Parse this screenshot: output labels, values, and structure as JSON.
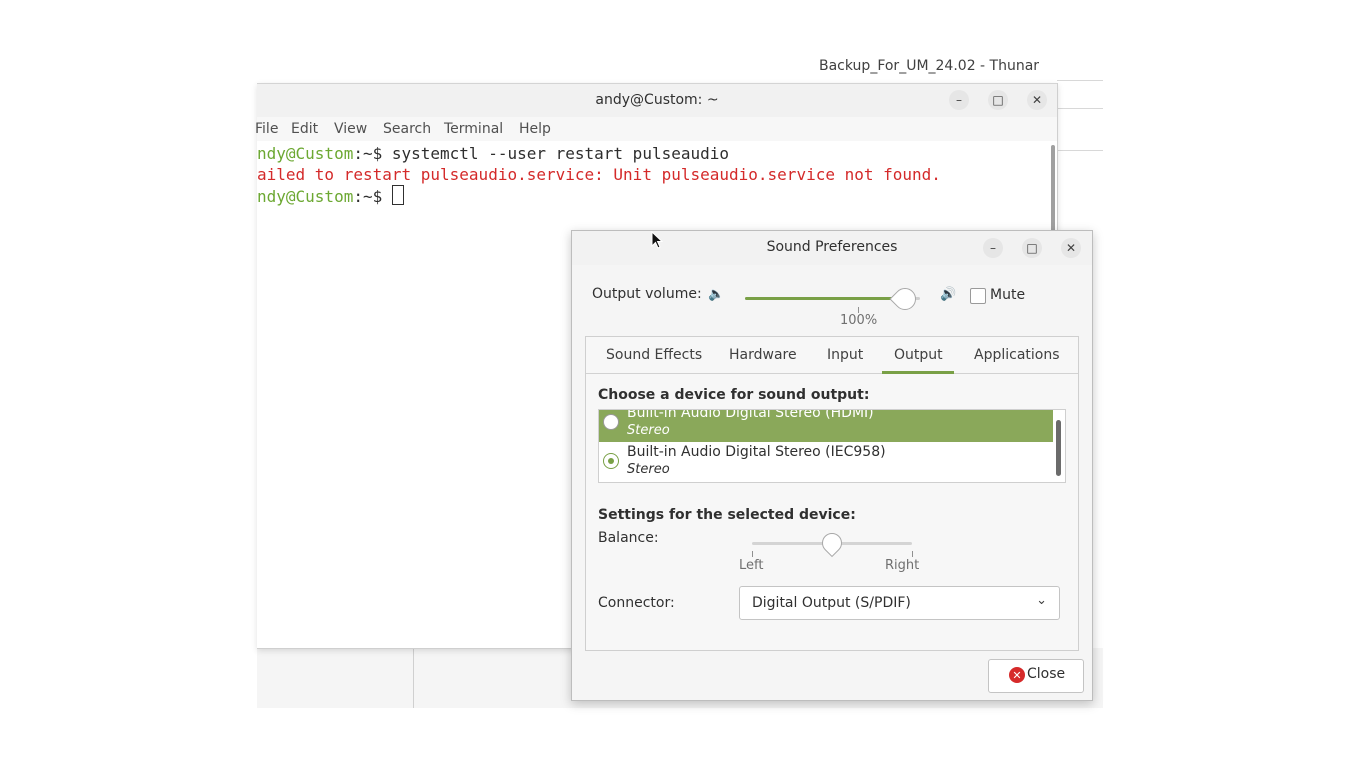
{
  "thunar": {
    "title": "Backup_For_UM_24.02 - Thunar"
  },
  "terminal": {
    "title": "andy@Custom: ~",
    "menu": [
      "File",
      "Edit",
      "View",
      "Search",
      "Terminal",
      "Help"
    ],
    "lines": [
      {
        "prompt_user": "ndy@Custom",
        "prompt_sep": ":~$ ",
        "command": "systemctl --user restart pulseaudio"
      },
      {
        "error": "ailed to restart pulseaudio.service: Unit pulseaudio.service not found."
      },
      {
        "prompt_user": "ndy@Custom",
        "prompt_sep": ":~$ ",
        "command": ""
      }
    ]
  },
  "sound": {
    "title": "Sound Preferences",
    "output_volume_label": "Output volume:",
    "volume_percent_label": "100%",
    "volume_level_fraction": 0.95,
    "mute_label": "Mute",
    "mute_checked": false,
    "tabs": [
      "Sound Effects",
      "Hardware",
      "Input",
      "Output",
      "Applications"
    ],
    "active_tab": "Output",
    "choose_label": "Choose a device for sound output:",
    "devices": [
      {
        "name": "Built-in Audio Digital Stereo (HDMI)",
        "profile": "Stereo",
        "highlighted": true,
        "selected": false
      },
      {
        "name": "Built-in Audio Digital Stereo (IEC958)",
        "profile": "Stereo",
        "highlighted": false,
        "selected": true
      }
    ],
    "settings_label": "Settings for the selected device:",
    "balance_label": "Balance:",
    "balance_left": "Left",
    "balance_right": "Right",
    "balance_fraction": 0.5,
    "connector_label": "Connector:",
    "connector_value": "Digital Output (S/PDIF)",
    "close_label": "Close"
  },
  "colors": {
    "accent": "#79a046",
    "selection": "#8aa85a",
    "error": "#d42a2a",
    "prompt": "#6ca832"
  },
  "icons": [
    "speaker-low-icon",
    "speaker-high-icon",
    "close-circle-icon",
    "chevron-down-icon",
    "minimize-icon",
    "maximize-icon",
    "window-close-icon"
  ]
}
